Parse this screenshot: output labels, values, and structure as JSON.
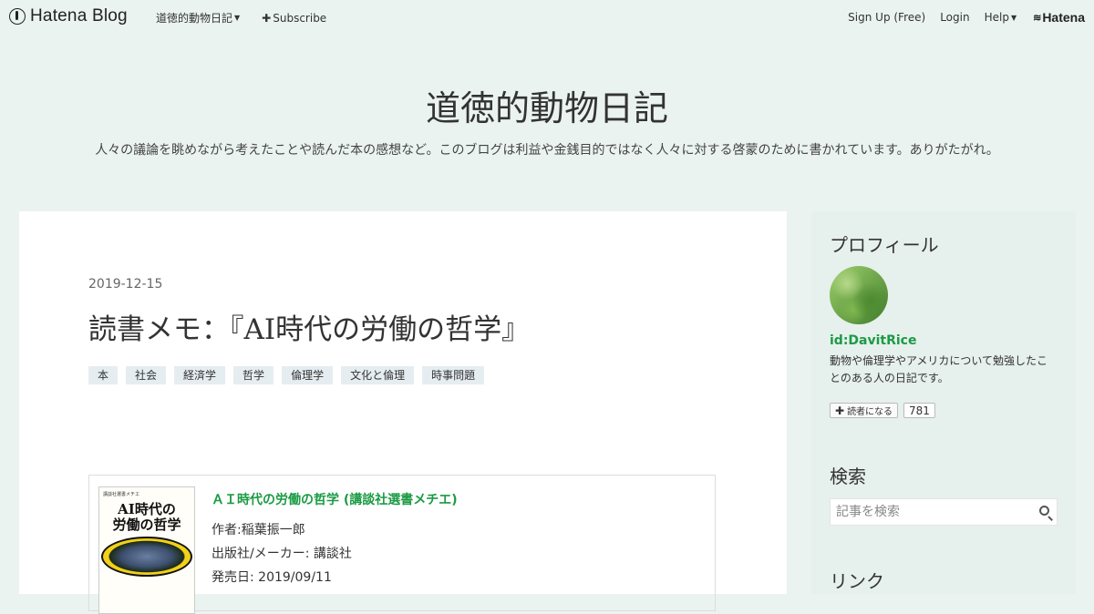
{
  "navbar": {
    "brand": "Hatena Blog",
    "blog_menu": "道徳的動物日記",
    "subscribe": "Subscribe",
    "signup": "Sign Up (Free)",
    "login": "Login",
    "help": "Help",
    "hatena": "Hatena"
  },
  "blog": {
    "title": "道徳的動物日記",
    "description": "人々の議論を眺めながら考えたことや読んだ本の感想など。このブログは利益や金銭目的ではなく人々に対する啓蒙のために書かれています。ありがたがれ。"
  },
  "entry": {
    "date": "2019-12-15",
    "title": "読書メモ：『AI時代の労働の哲学』",
    "tags": [
      "本",
      "社会",
      "経済学",
      "哲学",
      "倫理学",
      "文化と倫理",
      "時事問題"
    ]
  },
  "book": {
    "cover_series": "講談社選書メチエ",
    "cover_title_1": "AI時代の",
    "cover_title_2": "労働の哲学",
    "link": "ＡＩ時代の労働の哲学 (講談社選書メチエ)",
    "author": "作者:稲葉振一郎",
    "publisher": "出版社/メーカー: 講談社",
    "release": "発売日: 2019/09/11"
  },
  "sidebar": {
    "profile_heading": "プロフィール",
    "profile_id": "id:DavitRice",
    "profile_desc": "動物や倫理学やアメリカについて勉強したことのある人の日記です。",
    "subscribe_label": "読者になる",
    "subscriber_count": "781",
    "search_heading": "検索",
    "search_placeholder": "記事を検索",
    "next_heading": "リンク"
  }
}
